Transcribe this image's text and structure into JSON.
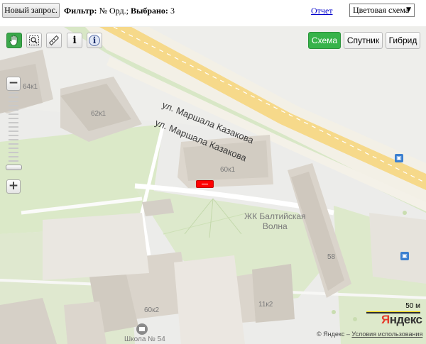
{
  "toolbar": {
    "new_query_label": "Новый запрос.",
    "filter_label": "Фильтр:",
    "filter_value": "№ Орд.;",
    "selected_label": "Выбрано:",
    "selected_value": "3",
    "report_link": "Отчет",
    "color_scheme_value": "Цветовая схема"
  },
  "map_tools": [
    {
      "name": "hand-icon",
      "active": true
    },
    {
      "name": "magnifier-select-icon",
      "active": false
    },
    {
      "name": "ruler-icon",
      "active": false
    },
    {
      "name": "info-icon",
      "label": "i",
      "active": false
    },
    {
      "name": "info-circle-icon",
      "label": "i",
      "active": false
    }
  ],
  "map_types": {
    "scheme": "Схема",
    "satellite": "Спутник",
    "hybrid": "Гибрид",
    "active": "scheme"
  },
  "zoom": {
    "plus": "+",
    "minus": "−",
    "level": 0.12
  },
  "map_labels": {
    "street_1": "ул. Маршала Казакова",
    "street_2": "ул. Маршала Казакова",
    "b_64k1": "64к1",
    "b_62k1": "62к1",
    "b_60k1": "60к1",
    "b_58": "58",
    "b_60k2": "60к2",
    "b_11k2": "11к2",
    "complex_line1": "ЖК Балтийская",
    "complex_line2": "Волна",
    "school": "Школа № 54"
  },
  "scale": {
    "label": "50 м"
  },
  "branding": {
    "logo_first": "Я",
    "logo_rest": "ндекс",
    "copyright": "© Яндекс –",
    "terms": "Условия использования"
  },
  "colors": {
    "active_tool": "#3aa84a",
    "marker": "#ff0000",
    "road": "#f6d98a",
    "greenery": "#dbe9c8",
    "building": "#dcd6cc"
  }
}
